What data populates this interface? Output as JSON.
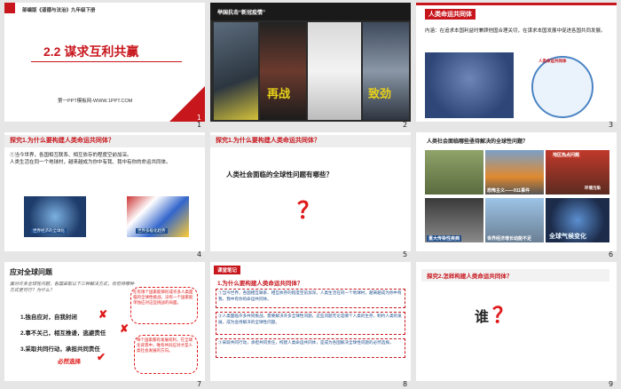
{
  "slides": [
    {
      "number": "1",
      "series": "部编版《道德与法治》九年级下册",
      "title": "2.2  谋求互利共赢",
      "footer": "第一PPT模板网-WWW.1PPT.COM"
    },
    {
      "number": "2",
      "banner": "举国抗击“新冠疫情”",
      "photo_text_a": "再战",
      "photo_text_b": "致劲"
    },
    {
      "number": "3",
      "heading": "人类命运共同体",
      "definition": "内涵：在追求本国利益时兼顾他国合理关切，在谋求本国发展中促进各国共同发展。",
      "circle_label": "人类命运共同体"
    },
    {
      "number": "4",
      "heading": "探究1.为什么要构建人类命运共同体？",
      "body_a": "①当今世界，各国相互联系、相互依存的程度空前加深。",
      "body_b": "人类生活在同一个地球村，越来越成为你中有我、我中有你的命运共同体。",
      "img1_label": "世界经济的全球化",
      "img2_label": "世界多极化趋势"
    },
    {
      "number": "5",
      "heading": "探究1.为什么要构建人类命运共同体？",
      "question": "人类社会面临的全球性问题有哪些？",
      "mark": "？"
    },
    {
      "number": "6",
      "heading": "人类社会面临哪些亟待解决的全球性问题？",
      "captions": [
        "恐怖主义——911事件",
        "地区热点问题",
        "重大传染性疾病",
        "世界经济增长动能不足",
        "全球气候变化",
        "环境污染"
      ]
    },
    {
      "number": "7",
      "heading": "应对全球问题",
      "note": "面对许多全球性问题，各国采取以下三种解决方式，你觉得哪种方式更可行？为什么？",
      "opt1": "1.独自应对，自我封闭",
      "opt2": "2.事不关己，相互推诿，逃避责任",
      "opt3": "3.采取共同行动，承担共同责任",
      "conclusion": "必然选择",
      "bubble1": "在有限个国家能够形成许多人类面临的全球性挑战，没有一个国家能单独应对这些挑战的局面。",
      "bubble2": "每个国家都有发展权利，在全球化背景中，唯有共同应对才是人类社会发展的方向。"
    },
    {
      "number": "8",
      "tag": "课堂笔记",
      "heading": "1.为什么要构建人类命运共同体？",
      "p1": "①当今世界，各国相互联系、相互依存的程度空前加深。人类生活在同一个地球村，越来越成为你中有我、我中有你的命运共同体。",
      "p2": "②人类面临许多共同挑战，需要解决许多全球性问题，这些问题无论是哪个人类的生存，制约人类的发展，成为亟待解决的全球性问题。",
      "p3": "③采取共同行动，承担共同责任，构建人类命运共同体，是成为各国解决全球性问题的必然选择。"
    },
    {
      "number": "9",
      "heading": "探究2.怎样构建人类命运共同体？",
      "question": "谁",
      "mark": "？"
    }
  ]
}
